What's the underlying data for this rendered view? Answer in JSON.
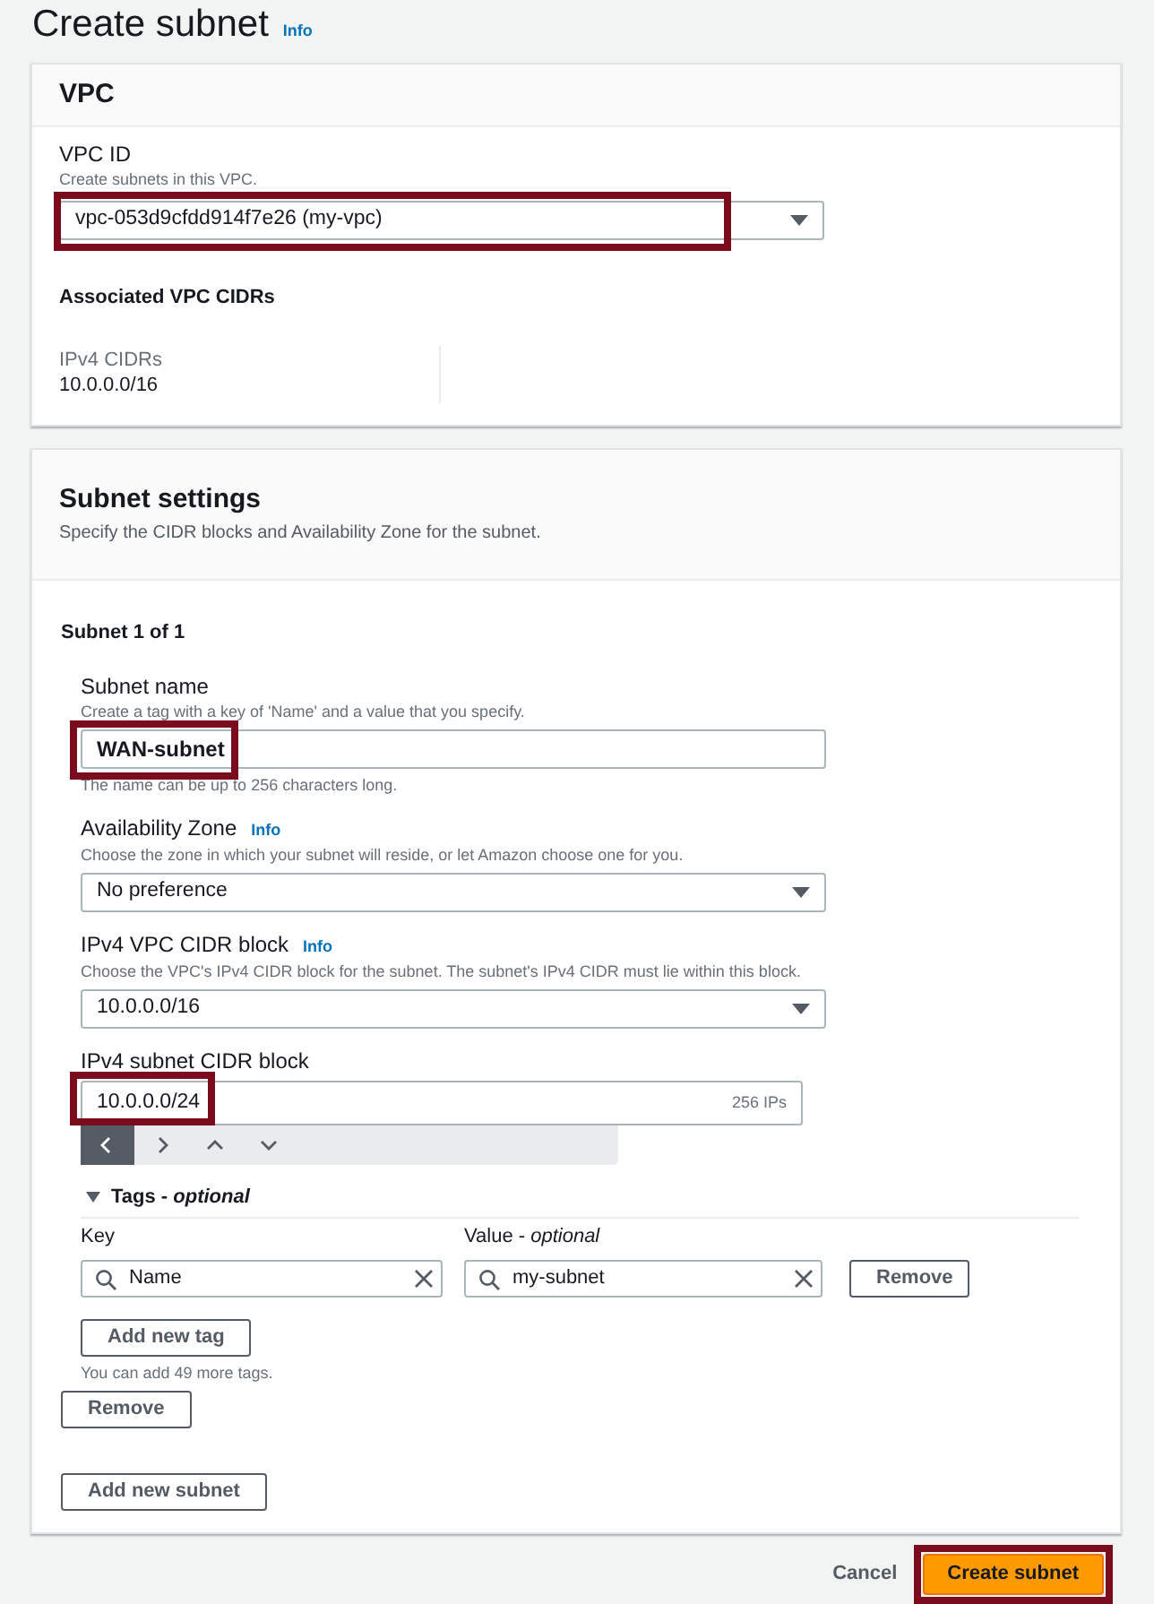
{
  "page": {
    "title": "Create subnet",
    "info_link": "Info"
  },
  "vpc_panel": {
    "heading": "VPC",
    "vpc_id": {
      "label": "VPC ID",
      "description": "Create subnets in this VPC.",
      "value": "vpc-053d9cfdd914f7e26 (my-vpc)",
      "highlighted": true
    },
    "cidrs_heading": "Associated VPC CIDRs",
    "cidrs": [
      {
        "label": "IPv4 CIDRs",
        "value": "10.0.0.0/16"
      }
    ]
  },
  "subnet_settings": {
    "heading": "Subnet settings",
    "description": "Specify the CIDR blocks and Availability Zone for the subnet.",
    "subnets": [
      {
        "title": "Subnet 1 of 1",
        "fields": [
          {
            "kind": "text",
            "label": "Subnet name",
            "description": "Create a tag with a key of 'Name' and a value that you specify.",
            "value": "WAN-subnet",
            "bold": true,
            "highlighted": true,
            "hint": "The name can be up to 256 characters long."
          },
          {
            "kind": "select",
            "label": "Availability Zone",
            "info_link": "Info",
            "description": "Choose the zone in which your subnet will reside, or let Amazon choose one for you.",
            "value": "No preference",
            "highlighted": false
          },
          {
            "kind": "select",
            "label": "IPv4 VPC CIDR block",
            "info_link": "Info",
            "description": "Choose the VPC's IPv4 CIDR block for the subnet. The subnet's IPv4 CIDR must lie within this block.",
            "value": "10.0.0.0/16",
            "highlighted": false
          },
          {
            "kind": "cidr",
            "label": "IPv4 subnet CIDR block",
            "value": "10.0.0.0/24",
            "ip_count": "256 IPs",
            "highlighted": true,
            "stepper": [
              {
                "selected": true
              },
              {
                "selected": false
              },
              {
                "selected": false
              },
              {
                "selected": false
              }
            ]
          }
        ],
        "tags": {
          "heading": "Tags - *optional*",
          "expanded": true,
          "key_label": "Key",
          "value_label": "Value - *optional*",
          "rows": [
            {
              "key": "Name",
              "value": "my-subnet",
              "remove_button": "Remove"
            }
          ],
          "add_button": "Add new tag",
          "limit_note": "You can add 49 more tags."
        },
        "remove_button": "Remove"
      }
    ],
    "add_subnet_button": "Add new subnet"
  },
  "footer": {
    "cancel_button": "Cancel",
    "submit_button": {
      "label": "Create subnet",
      "highlighted": true
    }
  }
}
